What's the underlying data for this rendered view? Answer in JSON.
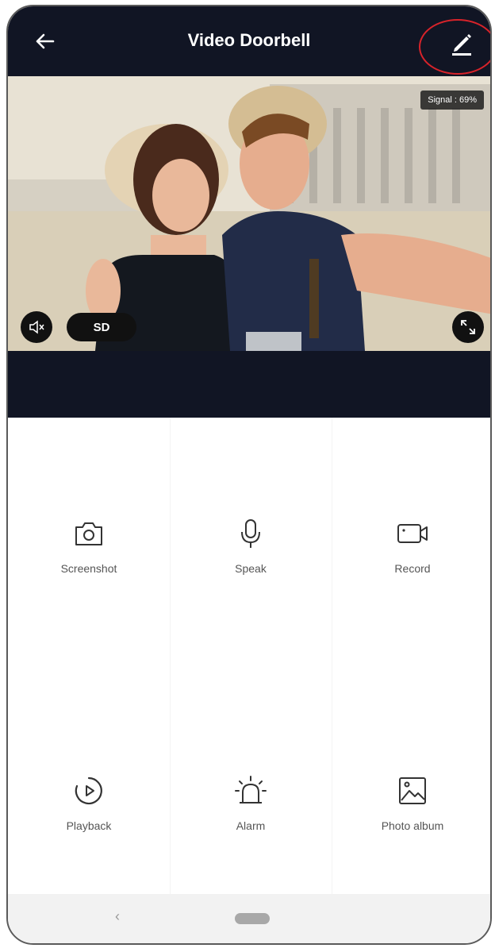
{
  "header": {
    "title": "Video Doorbell",
    "back_icon": "arrow-left-icon",
    "edit_icon": "pencil-icon"
  },
  "video": {
    "signal_text": "Signal : 69%",
    "quality_label": "SD",
    "mute_icon": "speaker-muted-icon",
    "fullscreen_icon": "fullscreen-icon"
  },
  "controls": [
    {
      "label": "Screenshot",
      "icon": "camera-icon"
    },
    {
      "label": "Speak",
      "icon": "microphone-icon"
    },
    {
      "label": "Record",
      "icon": "video-camera-icon"
    },
    {
      "label": "Playback",
      "icon": "playback-icon"
    },
    {
      "label": "Alarm",
      "icon": "alarm-siren-icon"
    },
    {
      "label": "Photo album",
      "icon": "image-icon"
    }
  ],
  "navbar": {
    "back_glyph": "‹"
  },
  "colors": {
    "header_bg": "#111524",
    "highlight_ring": "#d8232a"
  }
}
